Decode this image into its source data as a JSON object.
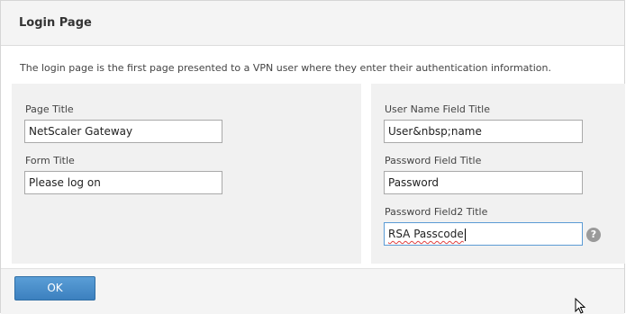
{
  "dialog": {
    "title": "Login Page",
    "description": "The login page is the first page presented to a VPN user where they enter their authentication information."
  },
  "left_panel": {
    "page_title": {
      "label": "Page Title",
      "value": "NetScaler Gateway"
    },
    "form_title": {
      "label": "Form Title",
      "value": "Please log on"
    }
  },
  "right_panel": {
    "username_title": {
      "label": "User Name Field Title",
      "value": "User&nbsp;name"
    },
    "password_title": {
      "label": "Password Field Title",
      "value": "Password"
    },
    "password2_title": {
      "label": "Password Field2 Title",
      "value": "RSA Passcode",
      "help_icon": "?"
    }
  },
  "footer": {
    "ok_label": "OK"
  },
  "colors": {
    "accent": "#3c80bf",
    "panel_bg": "#f1f1f1",
    "focus_border": "#5b9bd5"
  },
  "icons": {
    "help": "question-circle-icon",
    "pointer": "mouse-pointer-icon"
  }
}
